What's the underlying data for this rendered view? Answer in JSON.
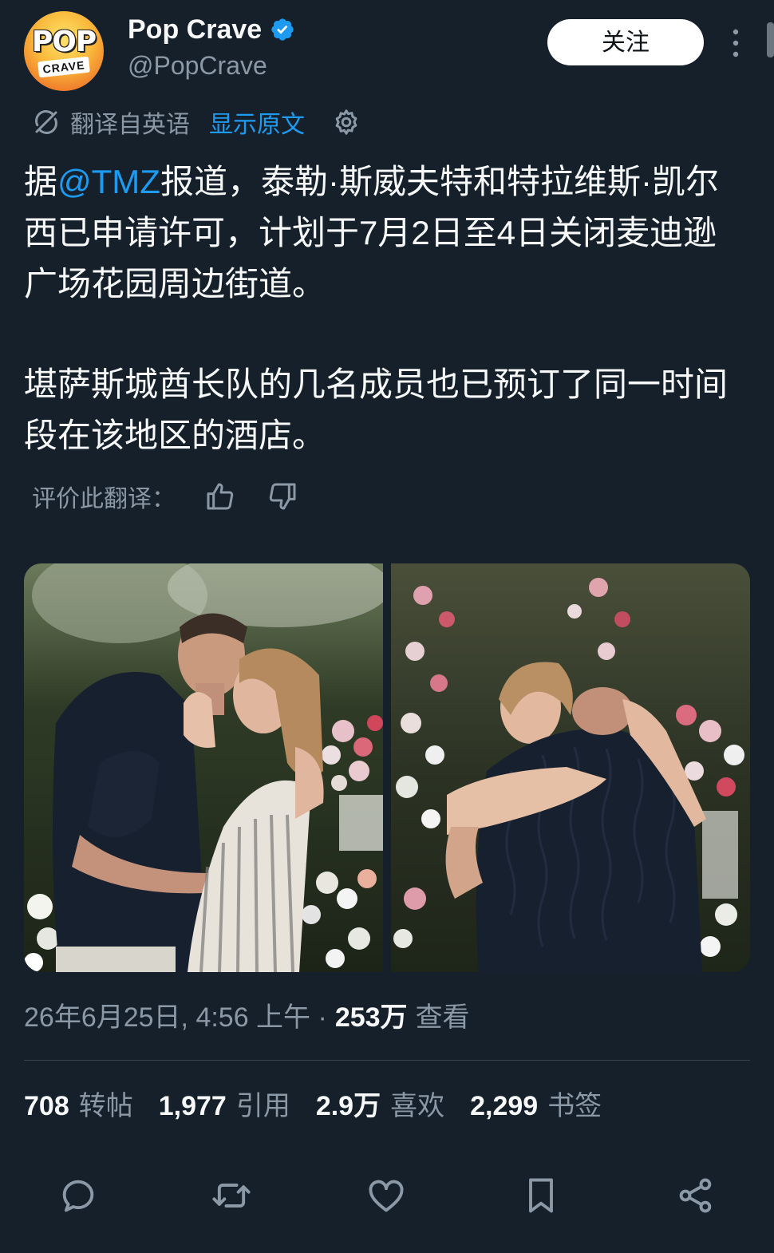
{
  "header": {
    "avatar_text_top": "POP",
    "avatar_text_bottom": "CRAVE",
    "display_name": "Pop Crave",
    "handle": "@PopCrave",
    "follow_label": "关注"
  },
  "translation_bar": {
    "translated_from": "翻译自英语",
    "show_original": "显示原文"
  },
  "tweet": {
    "p1_prefix": "据",
    "p1_mention": "@TMZ",
    "p1_rest": "报道，泰勒·斯威夫特和特拉维斯·凯尔西已申请许可，计划于7月2日至4日关闭麦迪逊广场花园周边街道。",
    "p2": "堪萨斯城酋长队的几名成员也已预订了同一时间段在该地区的酒店。"
  },
  "rate": {
    "label": "评价此翻译："
  },
  "meta": {
    "datetime": "26年6月25日, 4:56 上午 ·",
    "views_count": "253万",
    "views_label": "查看"
  },
  "stats": [
    {
      "num": "708",
      "label": "转帖"
    },
    {
      "num": "1,977",
      "label": "引用"
    },
    {
      "num": "2.9万",
      "label": "喜欢"
    },
    {
      "num": "2,299",
      "label": "书签"
    }
  ],
  "icons": {
    "verified": "verified-badge-icon",
    "more": "more-vertical-icon",
    "translate": "translate-icon",
    "settings": "gear-icon",
    "thumbs_up": "thumbs-up-icon",
    "thumbs_down": "thumbs-down-icon",
    "reply": "reply-icon",
    "repost": "repost-icon",
    "like": "heart-icon",
    "bookmark": "bookmark-icon",
    "share": "share-icon"
  },
  "colors": {
    "background": "#15202b",
    "accent": "#1d9bf0",
    "secondary_text": "#8b98a5",
    "primary_text": "#f7f9f9"
  }
}
